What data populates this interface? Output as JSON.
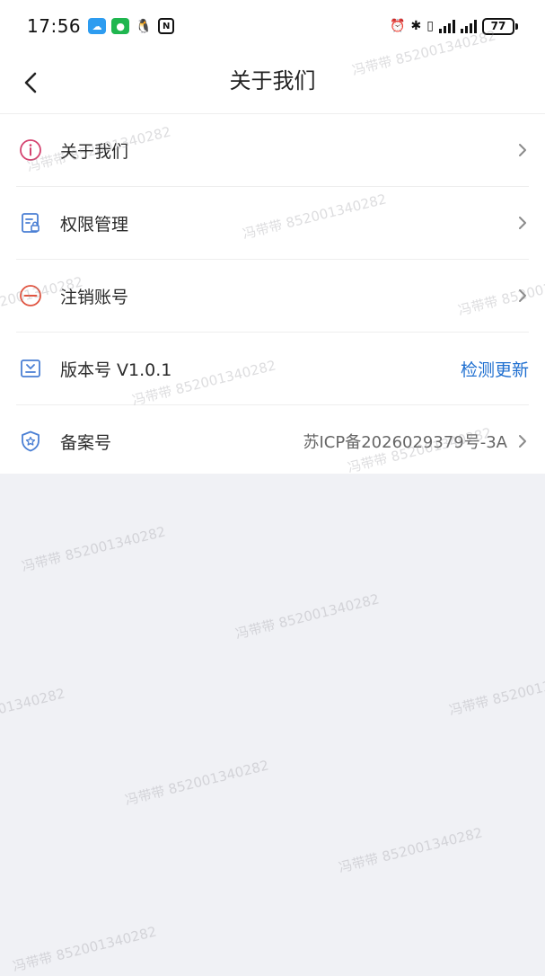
{
  "status_bar": {
    "time": "17:56",
    "battery": "77"
  },
  "header": {
    "title": "关于我们"
  },
  "items": [
    {
      "label": "关于我们",
      "icon": "info-icon",
      "color": "#d4426f"
    },
    {
      "label": "权限管理",
      "icon": "permission-icon",
      "color": "#4a7fd4"
    },
    {
      "label": "注销账号",
      "icon": "cancel-account-icon",
      "color": "#e0533f"
    },
    {
      "label": "版本号 V1.0.1",
      "icon": "version-icon",
      "color": "#4a7fd4",
      "action": "检测更新"
    },
    {
      "label": "备案号",
      "icon": "filing-shield-icon",
      "color": "#4a7fd4",
      "value": "苏ICP备2026029379号-3A"
    }
  ],
  "watermark": "冯带带 852001340282",
  "colors": {
    "accent": "#1f6fd0",
    "background": "#f0f1f5"
  }
}
